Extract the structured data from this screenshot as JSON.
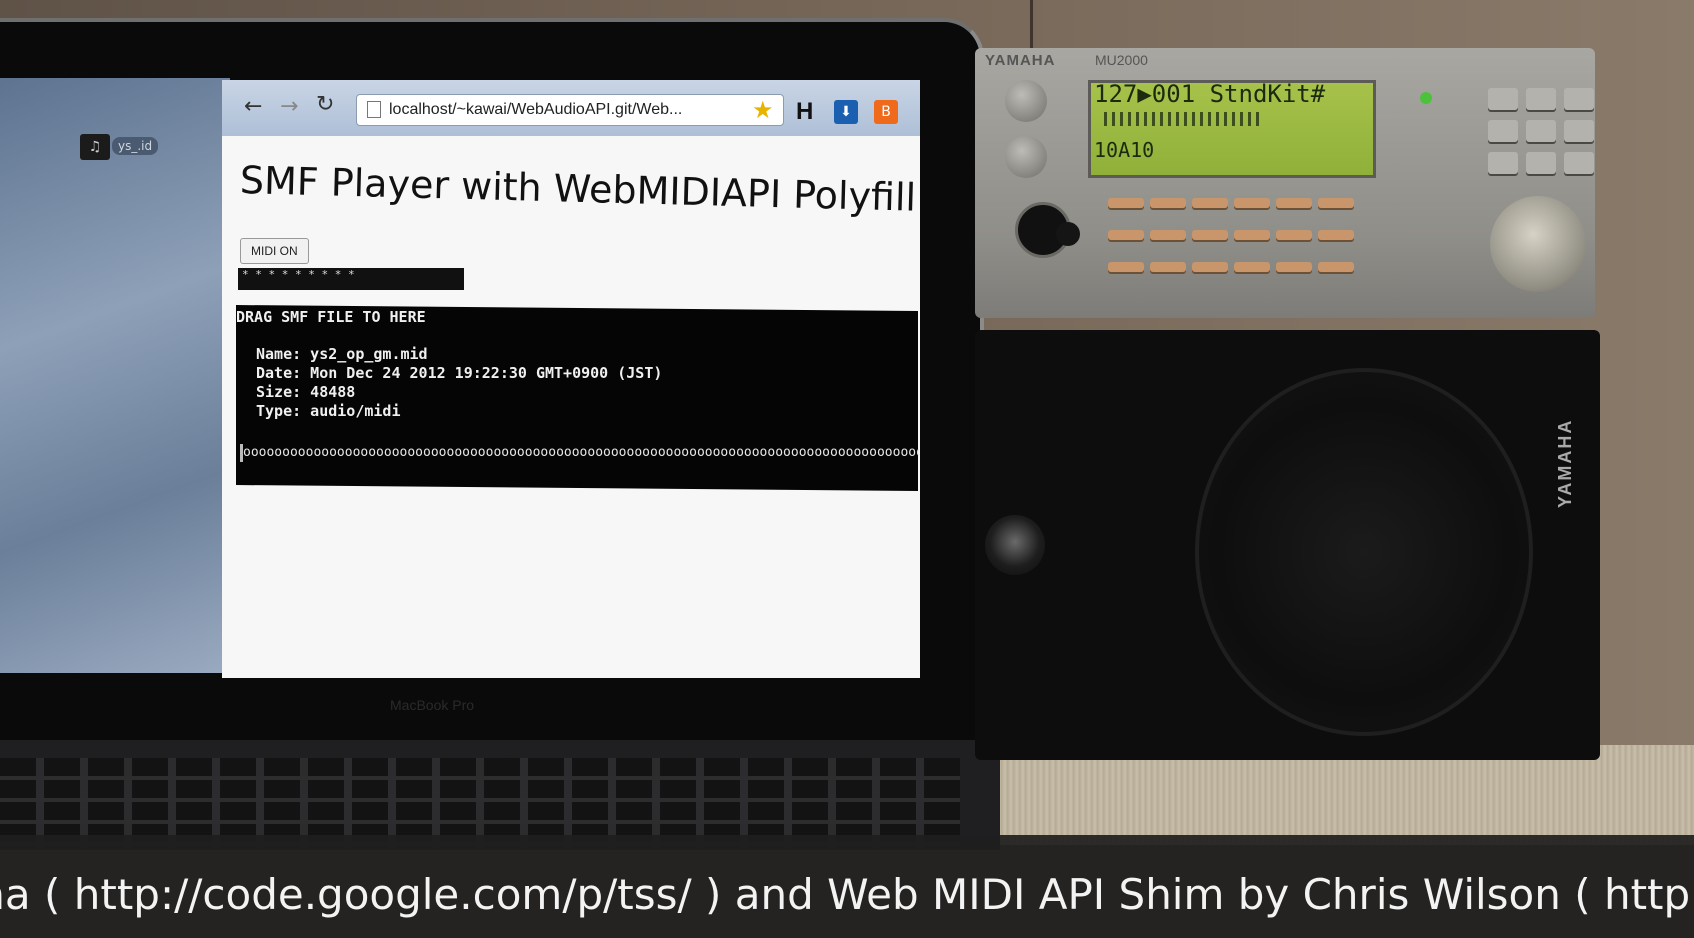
{
  "browser": {
    "url": "localhost/~kawai/WebAudioAPI.git/Web..."
  },
  "page": {
    "title": "SMF Player with WebMIDIAPI Polyfill",
    "midi_button": "MIDI ON",
    "midi_bar_text": "* * * * *   * *   * *",
    "drop_title": "DRAG SMF FILE TO HERE",
    "file": {
      "name": "Name: ys2_op_gm.mid",
      "date": "Date: Mon Dec 24 2012 19:22:30 GMT+0900 (JST)",
      "size": "Size: 48488",
      "type": "Type: audio/midi"
    },
    "progress": "oooooooooooooooooooooooooooooooooooooooooooooooooooooooooooooooooooooooooooooooooooooooooooo"
  },
  "desktop": {
    "icon_label": "ys_.id"
  },
  "laptop": {
    "brand": "MacBook Pro"
  },
  "synth": {
    "brand": "YAMAHA",
    "model": "MU2000",
    "lcd_line1": "127▶001 StndKit#",
    "lcd_line3": "10A10"
  },
  "speaker": {
    "brand": "YAMAHA"
  },
  "caption": {
    "text": "ma ( http://code.google.com/p/tss/ ) and Web MIDI API Shim by Chris Wilson ( http"
  },
  "colors": {
    "lcd": "#a7c24a",
    "synth_body": "#a8a7a2",
    "button_orange": "#c9956a",
    "caption_bg": "#1e1e1e"
  }
}
